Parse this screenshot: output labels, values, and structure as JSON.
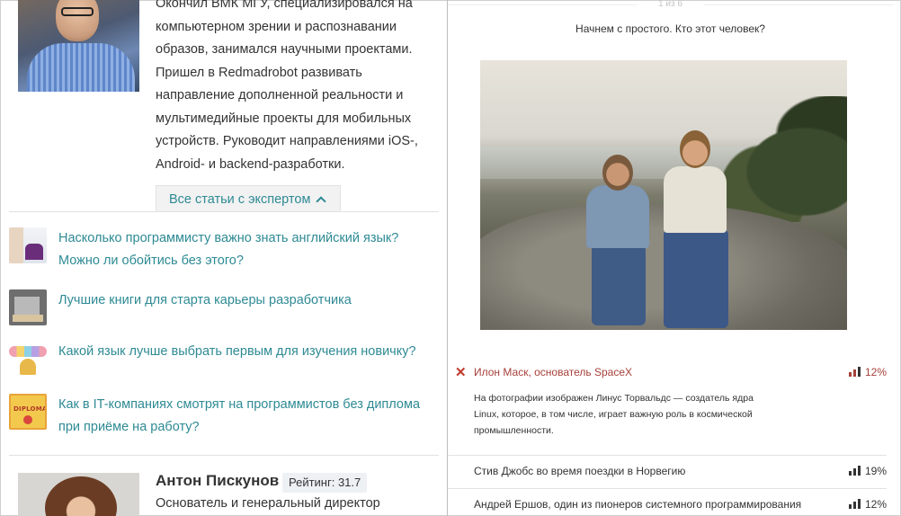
{
  "expert": {
    "bio": "Окончил ВМК МГУ, специализировался на компьютерном зрении и распознавании образов, занимался научными проектами. Пришел в Redmadrobot развивать направление дополненной реальности и мультимедийные проекты для мобильных устройств. Руководит направлениями iOS-, Android- и backend-разработки.",
    "all_articles_label": "Все статьи с экспертом"
  },
  "articles": [
    {
      "title": "Насколько программисту важно знать английский язык? Можно ли обойтись без этого?"
    },
    {
      "title": "Лучшие книги для старта карьеры разработчика"
    },
    {
      "title": "Какой язык лучше выбрать первым для изучения новичку?"
    },
    {
      "title": "Как в IT-компаниях смотрят на программистов без диплома при приёме на работу?",
      "thumb_text": "DIPLOMA"
    }
  ],
  "expert2": {
    "name": "Антон Пискунов",
    "rating": "Рейтинг: 31.7",
    "role": "Основатель и генеральный директор"
  },
  "quiz": {
    "counter": "1 из 6",
    "question": "Начнем с простого. Кто этот человек?",
    "answers": [
      {
        "text": "Илон Маск, основатель SpaceX",
        "percent": "12%",
        "state": "wrong",
        "explanation": "На фотографии изображен Линус Торвальдс — создатель ядра Linux, которое, в том числе, играет важную роль в космической промышленности."
      },
      {
        "text": "Стив Джобс во время поездки в Норвегию",
        "percent": "19%"
      },
      {
        "text": "Андрей Ершов, один из пионеров системного программирования",
        "percent": "12%"
      }
    ],
    "colors": {
      "link": "#2e8a94",
      "wrong": "#a6403a"
    }
  }
}
